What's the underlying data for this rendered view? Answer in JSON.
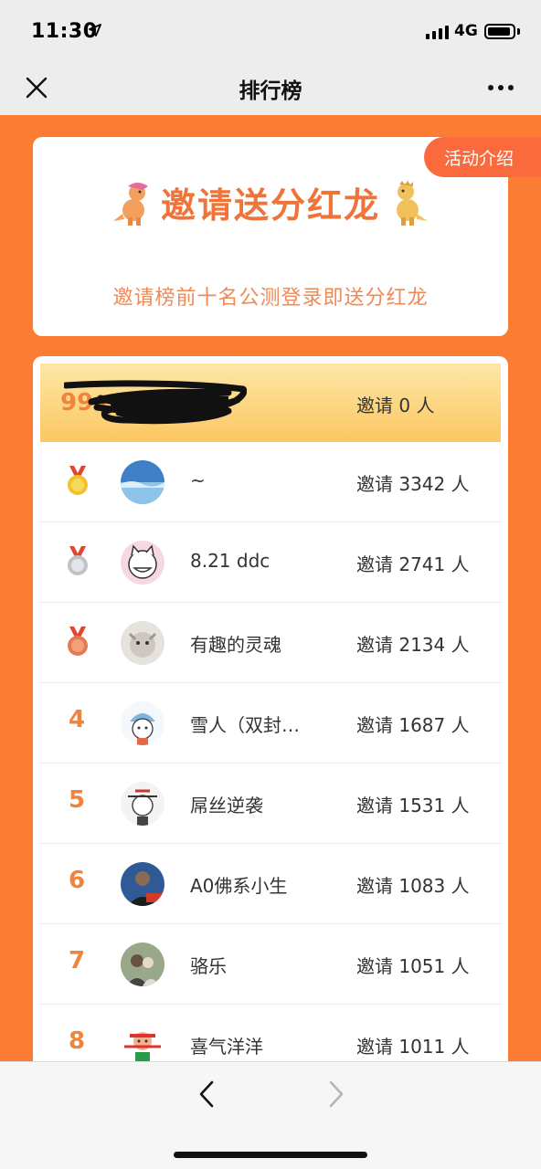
{
  "status_bar": {
    "time": "11:30",
    "network": "4G"
  },
  "nav": {
    "title": "排行榜"
  },
  "banner": {
    "rules_label": "活动介绍",
    "title": "邀请送分红龙",
    "subtitle": "邀请榜前十名公测登录即送分红龙"
  },
  "my_entry": {
    "rank": "99+",
    "invite_text": "邀请 0 人"
  },
  "rankings": [
    {
      "rank": "1",
      "medal": "gold-medal-icon",
      "avatar": "avatar-sky",
      "name": "~",
      "invite_text": "邀请 3342 人"
    },
    {
      "rank": "2",
      "medal": "silver-medal-icon",
      "avatar": "avatar-cat",
      "name": "8.21 ddc",
      "invite_text": "邀请 2741 人"
    },
    {
      "rank": "3",
      "medal": "bronze-medal-icon",
      "avatar": "avatar-pet",
      "name": "有趣的灵魂",
      "invite_text": "邀请 2134 人"
    },
    {
      "rank": "4",
      "avatar": "avatar-cartoon",
      "name": "雪人（双封…",
      "invite_text": "邀请 1687 人"
    },
    {
      "rank": "5",
      "avatar": "avatar-meme",
      "name": "屌丝逆袭",
      "invite_text": "邀请 1531 人"
    },
    {
      "rank": "6",
      "avatar": "avatar-person",
      "name": "A0佛系小生",
      "invite_text": "邀请 1083 人"
    },
    {
      "rank": "7",
      "avatar": "avatar-photo",
      "name": "骆乐",
      "invite_text": "邀请 1051 人"
    },
    {
      "rank": "8",
      "avatar": "avatar-character",
      "name": "喜气洋洋",
      "invite_text": "邀请 1011 人"
    }
  ],
  "colors": {
    "accent": "#fb7d34",
    "rank_text": "#f0843c",
    "title": "#f0743a"
  }
}
